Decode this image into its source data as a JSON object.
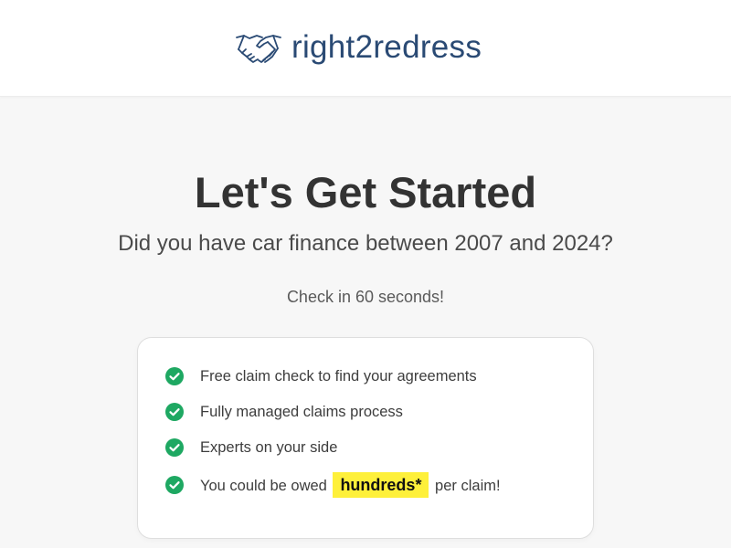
{
  "header": {
    "brand_name": "right2redress",
    "logo_icon": "handshake-icon",
    "brand_color": "#2a4a74"
  },
  "hero": {
    "title": "Let's Get Started",
    "subtitle": "Did you have car finance between 2007 and 2024?",
    "check_time": "Check in 60 seconds!"
  },
  "features": {
    "icon": "check-circle-icon",
    "icon_color": "#1ea862",
    "items": [
      "Free claim check to find your agreements",
      "Fully managed claims process",
      "Experts on your side"
    ],
    "owed": {
      "prefix": "You could be owed",
      "highlight": "hundreds*",
      "suffix": "per claim!",
      "highlight_color": "#fef03a"
    }
  }
}
